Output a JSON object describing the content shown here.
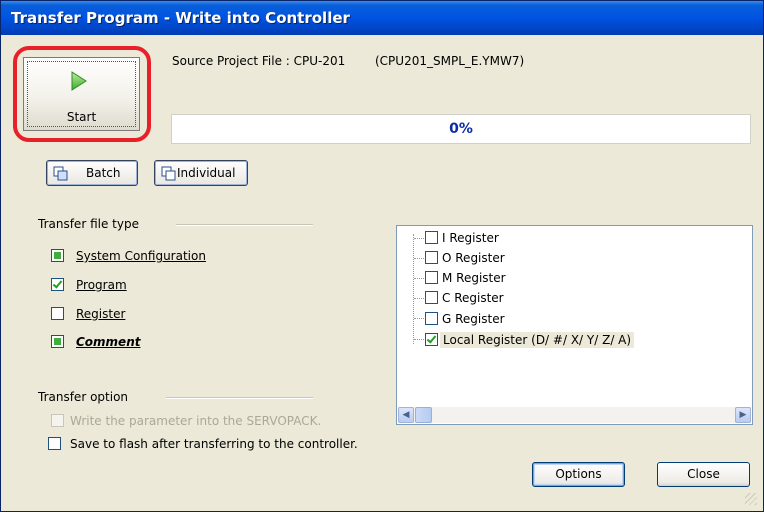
{
  "window": {
    "title": "Transfer Program - Write into Controller"
  },
  "header": {
    "source_label": "Source Project File : CPU-201",
    "source_file": "(CPU201_SMPL_E.YMW7)"
  },
  "start_button": {
    "label": "Start"
  },
  "progress": {
    "text": "0%",
    "value": 0
  },
  "mode_buttons": {
    "batch": "Batch",
    "individual": "Individual"
  },
  "file_type": {
    "label": "Transfer file type",
    "items": [
      {
        "label": "System Configuration",
        "state": "partial"
      },
      {
        "label": "Program",
        "state": "checked"
      },
      {
        "label": "Register",
        "state": "unchecked"
      },
      {
        "label": "Comment",
        "state": "partial"
      }
    ]
  },
  "registers": {
    "items": [
      {
        "label": "I Register",
        "checked": false
      },
      {
        "label": "O Register",
        "checked": false
      },
      {
        "label": "M Register",
        "checked": false
      },
      {
        "label": "C Register",
        "checked": false
      },
      {
        "label": "G Register",
        "checked": false
      },
      {
        "label": "Local Register (D/ #/ X/ Y/ Z/ A)",
        "checked": true
      }
    ]
  },
  "transfer_option": {
    "label": "Transfer option",
    "write_param": "Write the parameter into the SERVOPACK.",
    "save_flash": "Save to flash after transferring to the controller."
  },
  "buttons": {
    "options": "Options",
    "close": "Close"
  },
  "colors": {
    "title_bar": "#0054e3",
    "highlight_ring": "#e8202a",
    "progress_text": "#0a2ea6"
  }
}
